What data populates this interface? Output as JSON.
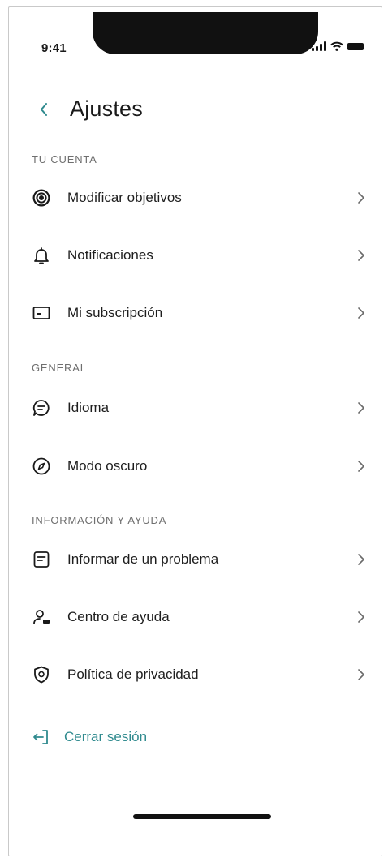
{
  "status_bar": {
    "time": "9:41"
  },
  "header": {
    "title": "Ajustes"
  },
  "sections": [
    {
      "label": "TU CUENTA",
      "items": [
        {
          "label": "Modificar objetivos",
          "icon": "target-icon"
        },
        {
          "label": "Notificaciones",
          "icon": "bell-icon"
        },
        {
          "label": "Mi subscripción",
          "icon": "card-icon"
        }
      ]
    },
    {
      "label": "GENERAL",
      "items": [
        {
          "label": "Idioma",
          "icon": "chat-icon"
        },
        {
          "label": "Modo oscuro",
          "icon": "compass-icon"
        }
      ]
    },
    {
      "label": "INFORMACIÓN Y AYUDA",
      "items": [
        {
          "label": "Informar de un problema",
          "icon": "report-icon"
        },
        {
          "label": "Centro de ayuda",
          "icon": "user-help-icon"
        },
        {
          "label": "Política de privacidad",
          "icon": "shield-icon"
        }
      ]
    }
  ],
  "logout": {
    "label": "Cerrar sesión"
  },
  "colors": {
    "accent": "#2f8a8e",
    "text": "#1e1e1e",
    "section_label": "#6f6f6f"
  }
}
